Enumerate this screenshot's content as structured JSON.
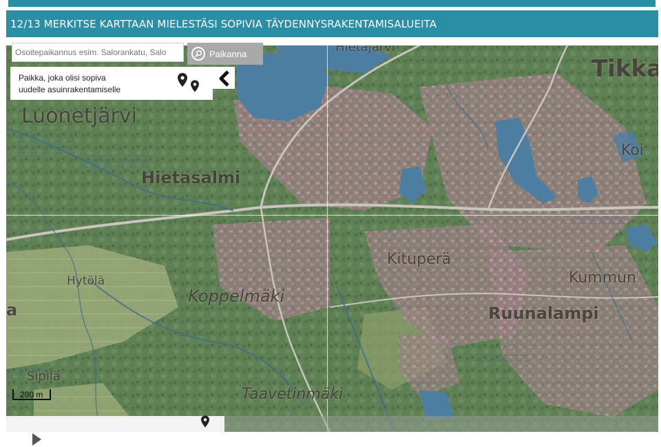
{
  "header": {
    "title": "12/13 MERKITSE KARTTAAN MIELESTÄSI SOPIVIA TÄYDENNYSRAKENTAMISALUEITA"
  },
  "search": {
    "placeholder": "Osoitepaikannus esim. Salorankatu, Salo",
    "button_label": "Paikanna"
  },
  "panel": {
    "line1": "Paikka, joka olisi sopiva",
    "line2": "uudelle asuinrakentamiselle"
  },
  "map": {
    "scale_label": "200 m",
    "places": [
      "Luonetjärvi",
      "Hietasalmi",
      "Hietajärvi",
      "Tikka",
      "Koi",
      "Kituperä",
      "Kummun",
      "Ruunalampi",
      "Hytölä",
      "Koppelmäki",
      "Sipilä",
      "Taavetinmäki",
      "a"
    ]
  },
  "colors": {
    "header_bg": "#2a8fa6",
    "map_base": "#6f8f5c",
    "water": "#4d7ea1"
  }
}
